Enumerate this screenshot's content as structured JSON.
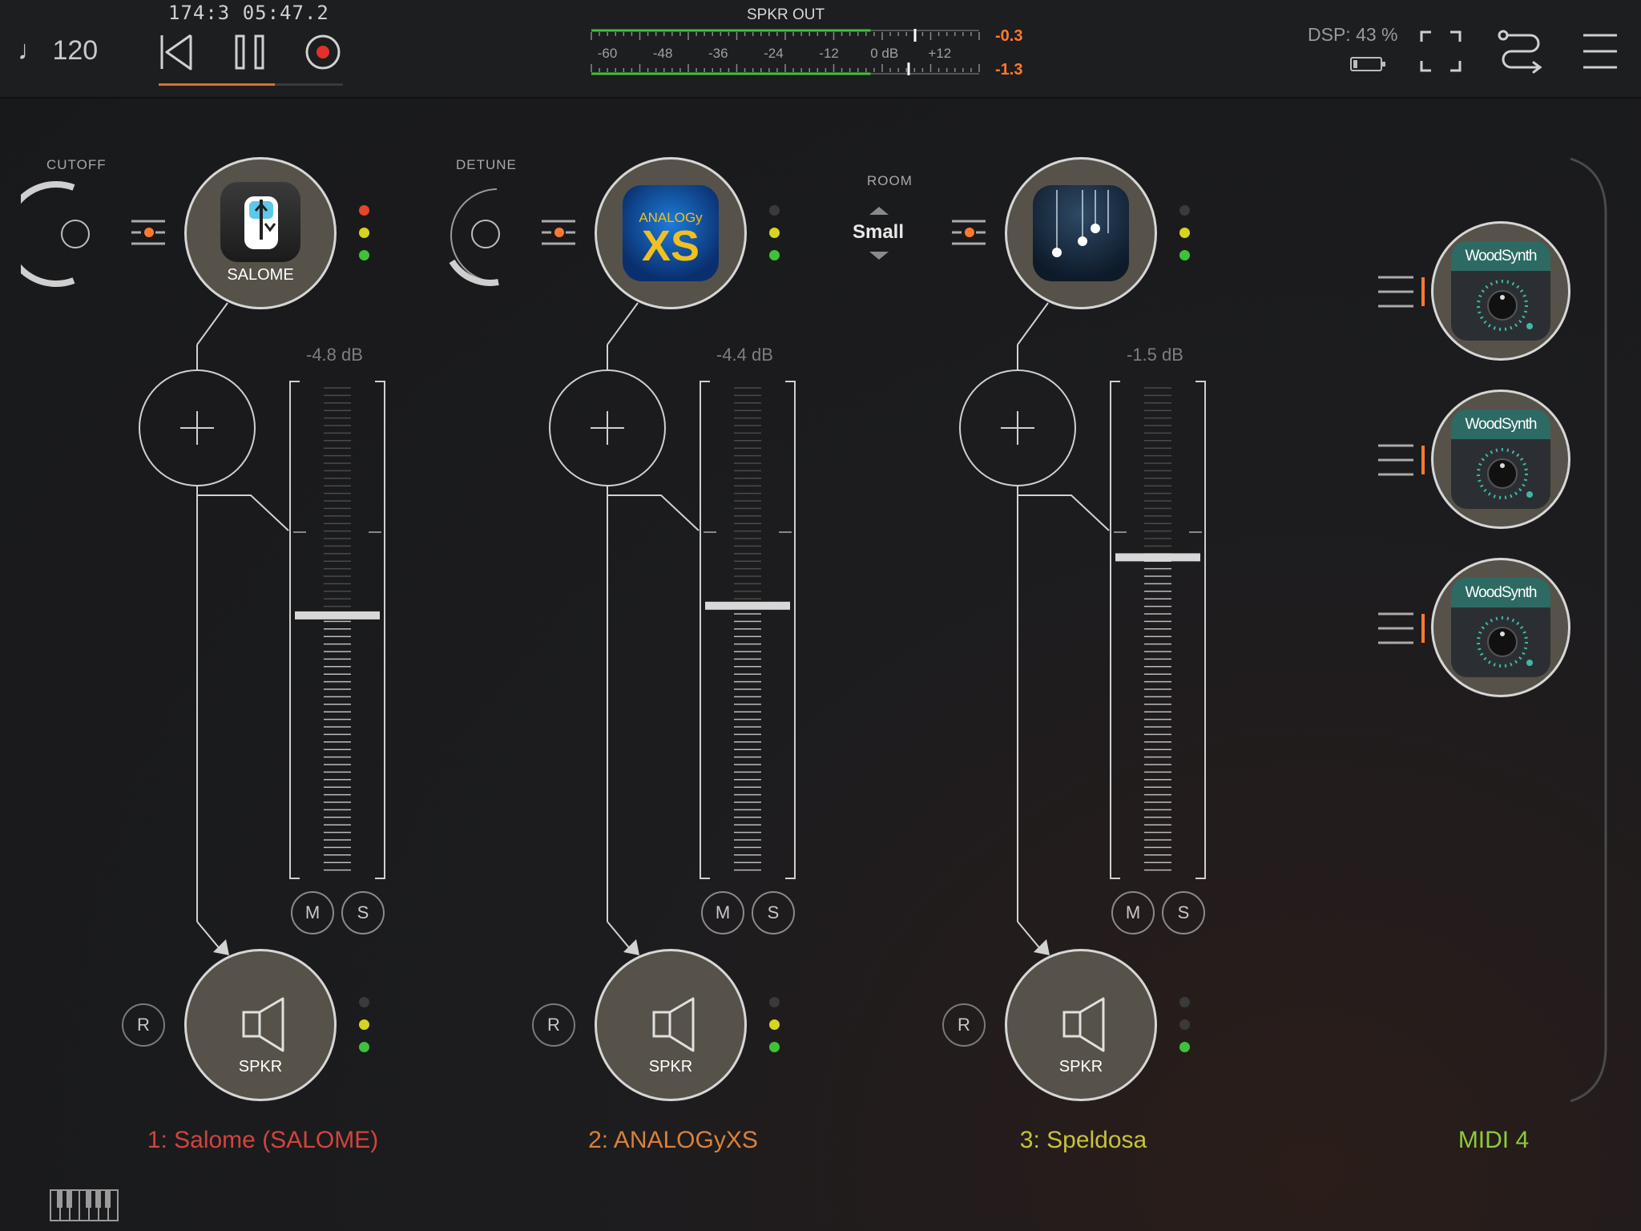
{
  "transport": {
    "tempo": "♩ 120",
    "position": "174:3  05:47.2",
    "rewind_icon": "skip-back-icon",
    "pause_icon": "pause-icon",
    "record_icon": "record-icon"
  },
  "meter": {
    "title": "SPKR OUT",
    "scale": [
      "-60",
      "-48",
      "-36",
      "-24",
      "-12",
      "0 dB",
      "+12"
    ],
    "peak_top": "-0.3",
    "peak_bottom": "-1.3",
    "level_top": 0.72,
    "level_bottom": 0.72
  },
  "status": {
    "dsp": "DSP: 43 %",
    "battery_icon": "battery-icon",
    "fullscreen_icon": "fullscreen-icon",
    "routing_icon": "routing-icon",
    "menu_icon": "menu-icon"
  },
  "channels": [
    {
      "param_label": "CUTOFF",
      "plugin_label": "SALOME",
      "volume": "-4.8 dB",
      "fader_level": 0.53,
      "mute": "M",
      "solo": "S",
      "record": "R",
      "output_label": "SPKR",
      "name": "1: Salome (SALOME)",
      "name_color": "#d2443c",
      "leds": [
        "#e5452c",
        "#d7d420",
        "#3fc23a"
      ],
      "out_leds": [
        "#3a3a3a",
        "#d7d420",
        "#3fc23a"
      ]
    },
    {
      "param_label": "DETUNE",
      "plugin_label": "",
      "volume": "-4.4 dB",
      "fader_level": 0.55,
      "mute": "M",
      "solo": "S",
      "record": "R",
      "output_label": "SPKR",
      "name": "2: ANALOGyXS",
      "name_color": "#d9813a",
      "leds": [
        "#3a3a3a",
        "#d7d420",
        "#3fc23a"
      ],
      "out_leds": [
        "#3a3a3a",
        "#d7d420",
        "#3fc23a"
      ]
    },
    {
      "param_label": "ROOM",
      "param_value": "Small",
      "plugin_label": "",
      "volume": "-1.5 dB",
      "fader_level": 0.65,
      "mute": "M",
      "solo": "S",
      "record": "R",
      "output_label": "SPKR",
      "name": "3: Speldosa",
      "name_color": "#c8c23a",
      "leds": [
        "#3a3a3a",
        "#d7d420",
        "#3fc23a"
      ],
      "out_leds": [
        "#3a3a3a",
        "#3a3a3a",
        "#3fc23a"
      ]
    }
  ],
  "midi": {
    "name": "MIDI 4",
    "name_color": "#8ecb3a",
    "plugins": [
      "WoodSynth",
      "WoodSynth",
      "WoodSynth"
    ]
  },
  "keyboard_icon": "piano-keyboard-icon"
}
